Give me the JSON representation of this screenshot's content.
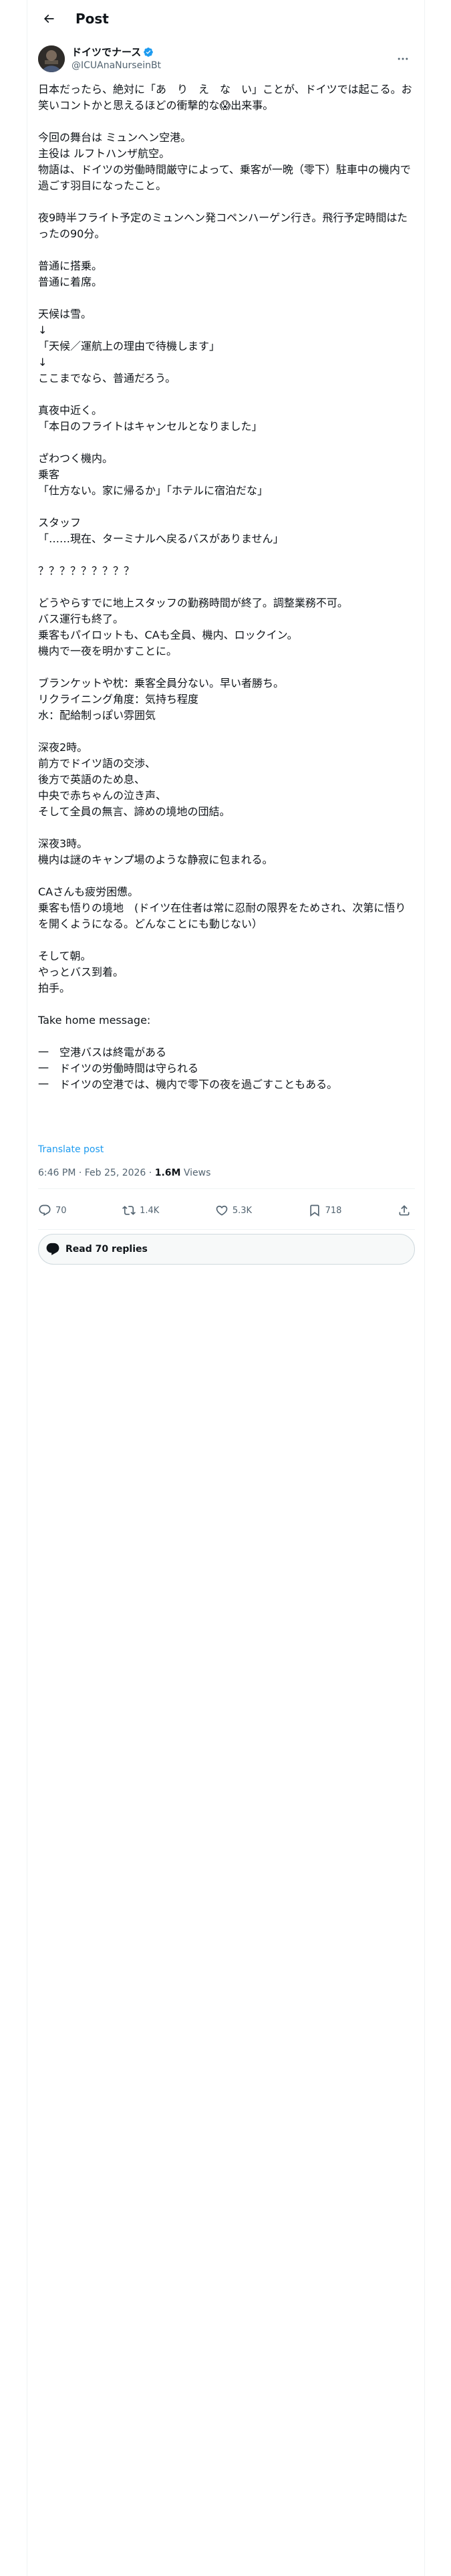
{
  "header": {
    "title": "Post"
  },
  "author": {
    "name": "ドイツでナース",
    "handle": "@ICUAnaNurseinBt"
  },
  "tweet": {
    "text": "日本だったら、絶対に「あ　り　え　な　い」ことが、ドイツでは起こる。お笑いコントかと思えるほどの衝撃的な😱出来事。\n\n今回の舞台は ミュンヘン空港。\n主役は ルフトハンザ航空。\n物語は、ドイツの労働時間厳守によって、乗客が一晩（零下）駐車中の機内で過ごす羽目になったこと。\n\n夜9時半フライト予定のミュンヘン発コペンハーゲン行き。飛行予定時間はたったの90分。\n\n普通に搭乗。\n普通に着席。\n\n天候は雪。\n↓\n「天候／運航上の理由で待機します」\n↓\nここまでなら、普通だろう。\n\n真夜中近く。\n「本日のフライトはキャンセルとなりました」\n\nざわつく機内。\n乗客\n「仕方ない。家に帰るか」「ホテルに宿泊だな」\n\nスタッフ\n「……現在、ターミナルへ戻るバスがありません」\n\n？？？？？？？？？\n\nどうやらすでに地上スタッフの勤務時間が終了。調整業務不可。\nバス運行も終了。\n乗客もパイロットも、CAも全員、機内、ロックイン。\n機内で一夜を明かすことに。\n\nブランケットや枕：乗客全員分ない。早い者勝ち。\nリクライニング角度：気持ち程度\n水：配給制っぽい雰囲気\n\n深夜2時。\n前方でドイツ語の交渉、\n後方で英語のため息、\n中央で赤ちゃんの泣き声、\nそして全員の無言、諦めの境地の団結。\n\n深夜3時。\n機内は謎のキャンプ場のような静寂に包まれる。\n\nCAさんも疲労困憊。\n乗客も悟りの境地　(ドイツ在住者は常に忍耐の限界をためされ、次第に悟りを開くようになる。どんなことにも動じない）\n\nそして朝。\nやっとバス到着。\n拍手。\n\nTake home message:\n\n一　空港バスは終電がある\n一　ドイツの労働時間は守られる\n一　ドイツの空港では、機内で零下の夜を過ごすこともある。",
    "translate_label": "Translate post",
    "timestamp": "6:46 PM · Feb 25, 2026 · ",
    "views_count": "1.6M",
    "views_label": " Views"
  },
  "actions": {
    "replies": "70",
    "reposts": "1.4K",
    "likes": "5.3K",
    "bookmarks": "718"
  },
  "read_replies_label": "Read 70 replies",
  "colors": {
    "accent": "#1d9bf0",
    "muted": "#536471",
    "text": "#0f1419",
    "border": "#eff3f4"
  }
}
